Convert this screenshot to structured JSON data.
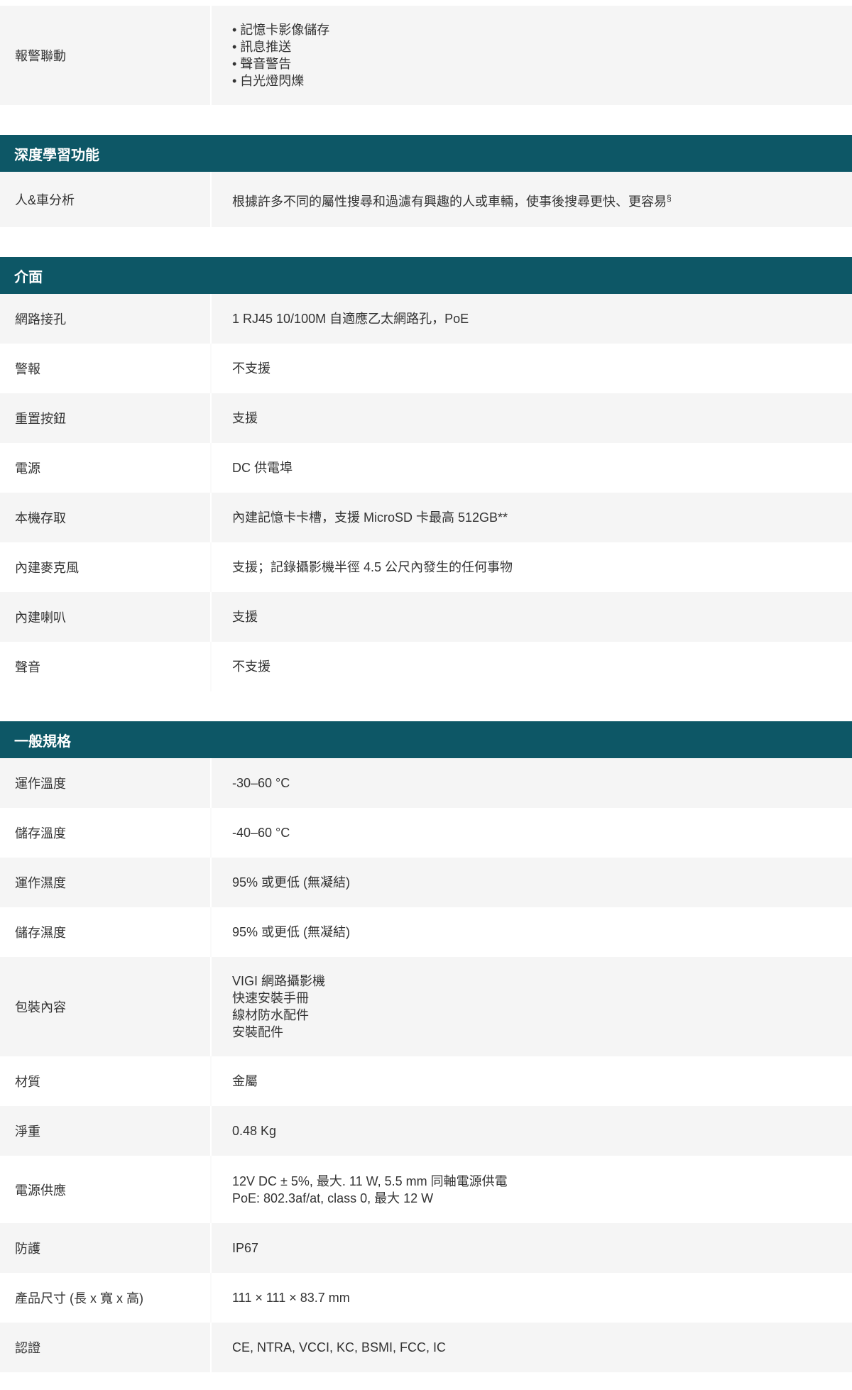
{
  "sections": [
    {
      "rows": [
        {
          "label": "報警聯動",
          "lines": [
            "• 記憶卡影像儲存",
            "• 訊息推送",
            "• 聲音警告",
            "• 白光燈閃爍"
          ]
        }
      ]
    },
    {
      "title": "深度學習功能",
      "rows": [
        {
          "label": "人&車分析",
          "lines": [
            "根據許多不同的屬性搜尋和過濾有興趣的人或車輛，使事後搜尋更快、更容易"
          ],
          "sup": "§"
        }
      ]
    },
    {
      "title": "介面",
      "rows": [
        {
          "label": "網路接孔",
          "lines": [
            "1 RJ45 10/100M 自適應乙太網路孔，PoE"
          ]
        },
        {
          "label": "警報",
          "lines": [
            "不支援"
          ]
        },
        {
          "label": "重置按鈕",
          "lines": [
            "支援"
          ]
        },
        {
          "label": "電源",
          "lines": [
            "DC 供電埠"
          ]
        },
        {
          "label": "本機存取",
          "lines": [
            "內建記憶卡卡槽，支援 MicroSD 卡最高 512GB**"
          ]
        },
        {
          "label": "內建麥克風",
          "lines": [
            "支援；記錄攝影機半徑 4.5 公尺內發生的任何事物"
          ]
        },
        {
          "label": "內建喇叭",
          "lines": [
            "支援"
          ]
        },
        {
          "label": "聲音",
          "lines": [
            "不支援"
          ]
        }
      ]
    },
    {
      "title": "一般規格",
      "rows": [
        {
          "label": "運作溫度",
          "lines": [
            "-30–60 °C"
          ]
        },
        {
          "label": "儲存溫度",
          "lines": [
            "-40–60 °C"
          ]
        },
        {
          "label": "運作濕度",
          "lines": [
            "95% 或更低 (無凝結)"
          ]
        },
        {
          "label": "儲存濕度",
          "lines": [
            "95% 或更低 (無凝結)"
          ]
        },
        {
          "label": "包裝內容",
          "lines": [
            "VIGI 網路攝影機",
            "快速安裝手冊",
            "線材防水配件",
            "安裝配件"
          ]
        },
        {
          "label": "材質",
          "lines": [
            "金屬"
          ]
        },
        {
          "label": "淨重",
          "lines": [
            "0.48 Kg"
          ]
        },
        {
          "label": "電源供應",
          "lines": [
            "12V DC ± 5%, 最大. 11 W, 5.5 mm 同軸電源供電",
            "PoE: 802.3af/at, class 0, 最大 12 W"
          ]
        },
        {
          "label": "防護",
          "lines": [
            "IP67"
          ]
        },
        {
          "label": "產品尺寸 (長 x 寬 x 高)",
          "lines": [
            "111 × 111 × 83.7 mm"
          ]
        },
        {
          "label": "認證",
          "lines": [
            "CE, NTRA, VCCI, KC, BSMI, FCC, IC"
          ]
        }
      ]
    }
  ]
}
